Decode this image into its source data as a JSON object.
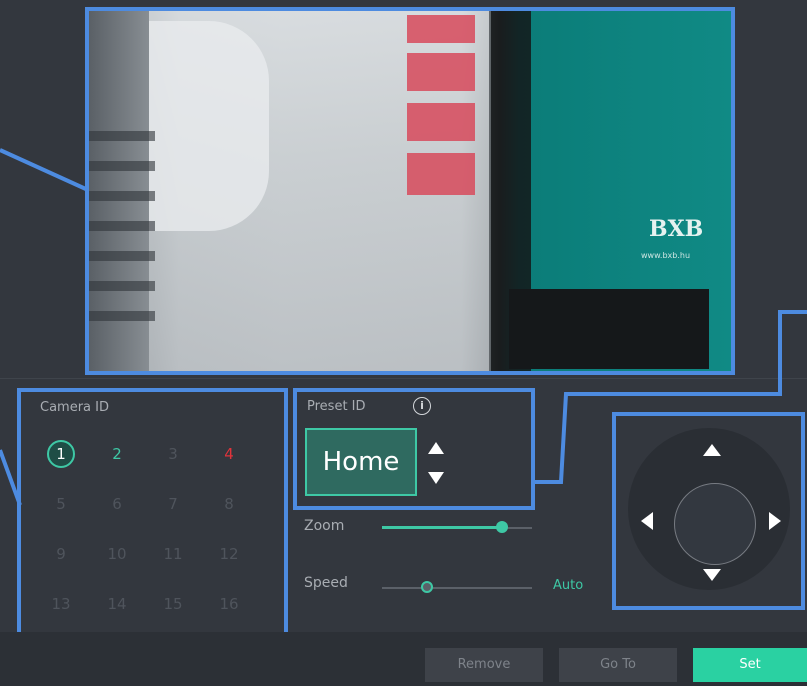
{
  "video": {
    "logo_text": "BXB",
    "logo_sub": "www.bxb.hu"
  },
  "camera_panel": {
    "title": "Camera ID",
    "ids": [
      "1",
      "2",
      "3",
      "4",
      "5",
      "6",
      "7",
      "8",
      "9",
      "10",
      "11",
      "12",
      "13",
      "14",
      "15",
      "16"
    ],
    "selected": "1",
    "online_green": [
      "2"
    ],
    "alert_red": [
      "4"
    ]
  },
  "preset_panel": {
    "title": "Preset ID",
    "info_icon": "i",
    "value": "Home",
    "up_icon": "arrow-up-icon",
    "down_icon": "arrow-down-icon"
  },
  "zoom": {
    "label": "Zoom",
    "level": 0.8
  },
  "speed": {
    "label": "Speed",
    "level": 0.3,
    "mode": "Auto"
  },
  "ptz": {
    "up": "up-arrow-icon",
    "down": "down-arrow-icon",
    "left": "left-arrow-icon",
    "right": "right-arrow-icon"
  },
  "actions": {
    "remove": "Remove",
    "goto": "Go To",
    "set": "Set"
  },
  "colors": {
    "accent": "#3ec8a5",
    "highlight": "#4d8be0",
    "alert": "#e0333b",
    "background": "#33373e"
  }
}
